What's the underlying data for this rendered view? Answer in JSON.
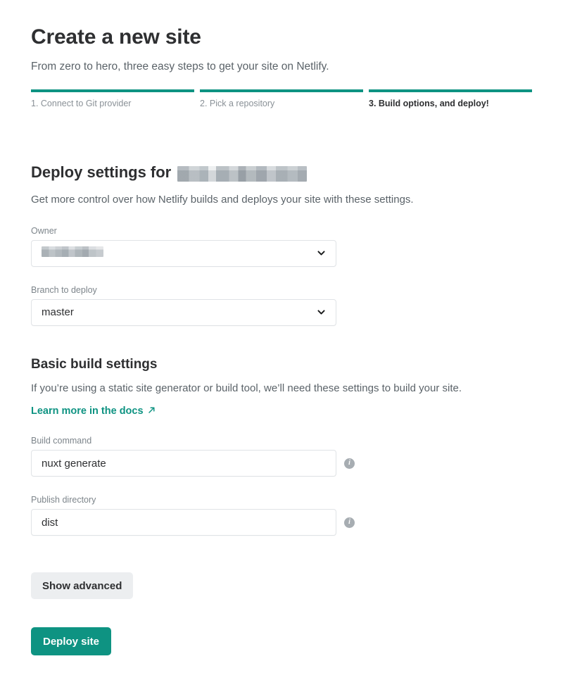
{
  "header": {
    "title": "Create a new site",
    "subtitle": "From zero to hero, three easy steps to get your site on Netlify."
  },
  "stepper": {
    "steps": [
      {
        "label": "1. Connect to Git provider",
        "active": false
      },
      {
        "label": "2. Pick a repository",
        "active": false
      },
      {
        "label": "3. Build options, and deploy!",
        "active": true
      }
    ]
  },
  "deploy_settings": {
    "heading_lead": "Deploy settings for",
    "heading_repo_redacted": true,
    "description": "Get more control over how Netlify builds and deploys your site with these settings.",
    "owner": {
      "label": "Owner",
      "value_redacted": true,
      "chevron_icon": "chevron-down-icon"
    },
    "branch": {
      "label": "Branch to deploy",
      "value": "master",
      "chevron_icon": "chevron-down-icon"
    }
  },
  "build_settings": {
    "heading": "Basic build settings",
    "description": "If you’re using a static site generator or build tool, we’ll need these settings to build your site.",
    "docs_link": {
      "label": "Learn more in the docs",
      "icon": "external-link-arrow-icon"
    },
    "build_command": {
      "label": "Build command",
      "value": "nuxt generate",
      "placeholder": "",
      "info_icon": "info-icon",
      "info_glyph": "i"
    },
    "publish_directory": {
      "label": "Publish directory",
      "value": "dist",
      "placeholder": "",
      "info_icon": "info-icon",
      "info_glyph": "i"
    }
  },
  "actions": {
    "show_advanced": "Show advanced",
    "deploy_site": "Deploy site"
  },
  "colors": {
    "brand_teal": "#0e9382",
    "text_primary": "#2e2f31",
    "text_muted": "#5b6369",
    "label_gray": "#7d858b",
    "border_gray": "#e0e3e6",
    "button_secondary_bg": "#eceef0",
    "info_icon_gray": "#a7adb2"
  }
}
